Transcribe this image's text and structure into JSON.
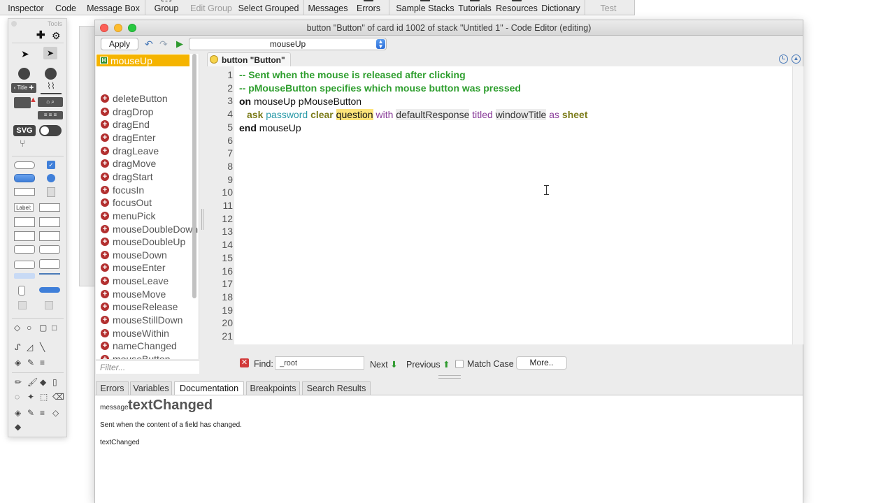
{
  "toolbar": {
    "items": [
      {
        "label": "Inspector",
        "dim": false
      },
      {
        "label": "Code",
        "dim": false
      },
      {
        "label": "Message Box",
        "dim": false
      },
      {
        "label": "Group",
        "dim": false
      },
      {
        "label": "Edit Group",
        "dim": true
      },
      {
        "label": "Select Grouped",
        "dim": false
      },
      {
        "label": "Messages",
        "dim": false
      },
      {
        "label": "Errors",
        "dim": false
      },
      {
        "label": "Sample Stacks",
        "dim": false
      },
      {
        "label": "Tutorials",
        "dim": false
      },
      {
        "label": "Resources",
        "dim": false
      },
      {
        "label": "Dictionary",
        "dim": false
      },
      {
        "label": "Test",
        "dim": true
      }
    ]
  },
  "tools_palette": {
    "title": "Tools",
    "label_button": "Title",
    "svg_label": "SVG",
    "label_field": "Label:"
  },
  "window": {
    "title": "button \"Button\" of card id 1002 of stack \"Untitled 1\" - Code Editor (editing)",
    "apply_label": "Apply",
    "handler_select_value": "mouseUp",
    "selected_handler": "mouseUp",
    "selected_badge": "H",
    "handlers": [
      "deleteButton",
      "dragDrop",
      "dragEnd",
      "dragEnter",
      "dragLeave",
      "dragMove",
      "dragStart",
      "focusIn",
      "focusOut",
      "menuPick",
      "mouseDoubleDown",
      "mouseDoubleUp",
      "mouseDown",
      "mouseEnter",
      "mouseLeave",
      "mouseMove",
      "mouseRelease",
      "mouseStillDown",
      "mouseWithin",
      "nameChanged",
      "mouseButton"
    ],
    "filter_placeholder": "Filter...",
    "tab_label": "button \"Button\""
  },
  "editor": {
    "line_numbers": [
      "1",
      "2",
      "3",
      "4",
      "5",
      "6",
      "7",
      "8",
      "9",
      "10",
      "11",
      "12",
      "13",
      "14",
      "15",
      "16",
      "17",
      "18",
      "19",
      "20",
      "21"
    ],
    "line1": "-- Sent when the mouse is released after clicking",
    "line2": "-- pMouseButton specifies which mouse button was pressed",
    "line3": {
      "kw": "on",
      "rest": " mouseUp pMouseButton"
    },
    "line4": {
      "ask": "ask",
      "password": "password",
      "clear": "clear",
      "question": "question",
      "with": "with",
      "defaultResponse": "defaultResponse",
      "titled": "titled",
      "windowTitle": "windowTitle",
      "as": "as",
      "sheet": "sheet"
    },
    "line5": {
      "kw": "end",
      "rest": " mouseUp"
    }
  },
  "findbar": {
    "find_label": "Find:",
    "find_value": "_root",
    "next_label": "Next",
    "previous_label": "Previous",
    "match_case_label": "Match Case",
    "more_label": "More.."
  },
  "bottom_tabs": [
    "Errors",
    "Variables",
    "Documentation",
    "Breakpoints",
    "Search Results"
  ],
  "documentation": {
    "kind": "message",
    "name": "textChanged",
    "description": "Sent when the content of a field has changed.",
    "syntax": "textChanged"
  },
  "colors": {
    "selected_handler_bg": "#f5b400",
    "comment": "#2e9e2e",
    "highlight": "#fde47a"
  }
}
